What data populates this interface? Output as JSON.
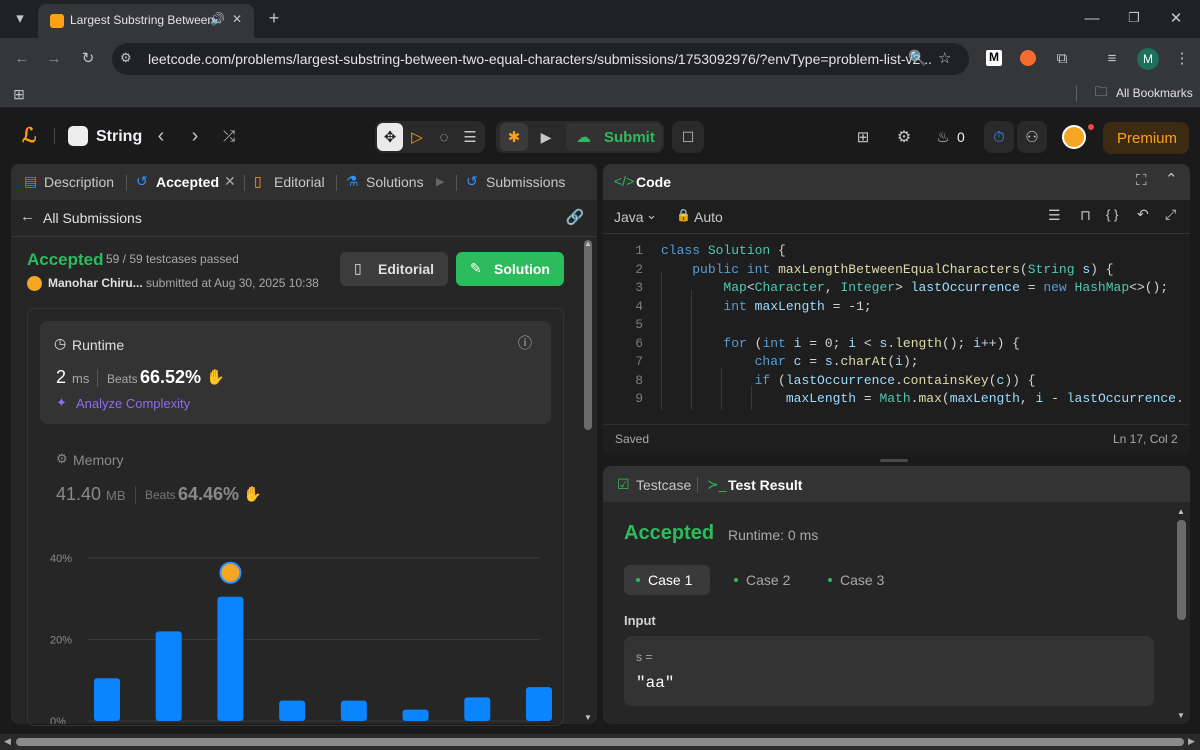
{
  "browser": {
    "tab_title": "Largest Substring Between",
    "url": "leetcode.com/problems/largest-substring-between-two-equal-characters/submissions/1753092976/?envType=problem-list-v2...",
    "all_bookmarks": "All Bookmarks",
    "profile_initial": "M"
  },
  "nav": {
    "problem_list": "String",
    "submit": "Submit",
    "streak": "0",
    "premium": "Premium"
  },
  "left_tabs": {
    "description": "Description",
    "accepted": "Accepted",
    "editorial": "Editorial",
    "solutions": "Solutions",
    "submissions": "Submissions"
  },
  "submission": {
    "back_label": "All Submissions",
    "status": "Accepted",
    "testcases": "59 / 59 testcases passed",
    "user": "Manohar Chiru...",
    "submitted": "submitted at Aug 30, 2025 10:38",
    "editorial_button": "Editorial",
    "solution_button": "Solution",
    "runtime_label": "Runtime",
    "runtime_value": "2",
    "runtime_unit": "ms",
    "beats_label": "Beats",
    "runtime_beats": "66.52%",
    "analyze": "Analyze Complexity",
    "memory_label": "Memory",
    "memory_value": "41.40",
    "memory_unit": "MB",
    "memory_beats": "64.46%"
  },
  "chart_data": {
    "type": "bar",
    "y_ticks": [
      "40%",
      "20%",
      "0%"
    ],
    "ylim": [
      0,
      40
    ],
    "values": [
      10.5,
      22,
      30.5,
      5,
      5,
      2.8,
      5.8,
      8.3
    ],
    "highlight_index": 2
  },
  "code": {
    "title": "Code",
    "language": "Java",
    "mode": "Auto",
    "status": "Saved",
    "cursor": "Ln 17, Col 2",
    "lines": [
      "class Solution {",
      "    public int maxLengthBetweenEqualCharacters(String s) {",
      "        Map<Character, Integer> lastOccurrence = new HashMap<>();",
      "        int maxLength = -1;",
      "",
      "        for (int i = 0; i < s.length(); i++) {",
      "            char c = s.charAt(i);",
      "            if (lastOccurrence.containsKey(c)) {",
      "                maxLength = Math.max(maxLength, i - lastOccurrence."
    ]
  },
  "result": {
    "testcase_tab": "Testcase",
    "result_tab": "Test Result",
    "status": "Accepted",
    "runtime": "Runtime: 0 ms",
    "cases": [
      "Case 1",
      "Case 2",
      "Case 3"
    ],
    "input_label": "Input",
    "var_label": "s =",
    "var_value": "\"aa\""
  },
  "colors": {
    "accent_green": "#2cbb5d",
    "bar_blue": "#0a84ff",
    "premium": "#ffa116"
  }
}
